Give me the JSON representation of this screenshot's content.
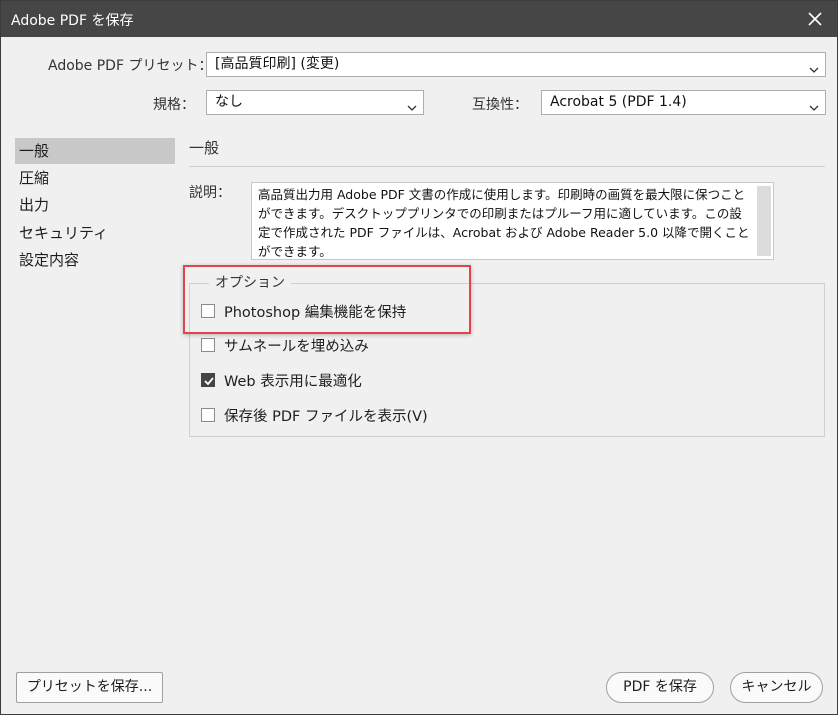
{
  "window": {
    "title": "Adobe PDF を保存"
  },
  "preset": {
    "label": "Adobe PDF プリセット：",
    "value": "[高品質印刷] (変更)"
  },
  "standard": {
    "label": "規格：",
    "value": "なし"
  },
  "compatibility": {
    "label": "互換性：",
    "value": "Acrobat 5 (PDF 1.4)"
  },
  "sidebar": {
    "items": [
      {
        "label": "一般",
        "selected": true
      },
      {
        "label": "圧縮",
        "selected": false
      },
      {
        "label": "出力",
        "selected": false
      },
      {
        "label": "セキュリティ",
        "selected": false
      },
      {
        "label": "設定内容",
        "selected": false
      }
    ]
  },
  "main": {
    "section_title": "一般",
    "description_label": "説明：",
    "description_text": "高品質出力用 Adobe PDF 文書の作成に使用します。印刷時の画質を最大限に保つことができます。デスクトッププリンタでの印刷またはプルーフ用に適しています。この設定で作成された PDF ファイルは、Acrobat および Adobe Reader 5.0 以降で開くことができます。",
    "options_title": "オプション",
    "options": [
      {
        "label": "Photoshop 編集機能を保持",
        "checked": false
      },
      {
        "label": "サムネールを埋め込み",
        "checked": false
      },
      {
        "label": "Web 表示用に最適化",
        "checked": true
      },
      {
        "label": "保存後 PDF ファイルを表示(V)",
        "checked": false
      }
    ]
  },
  "footer": {
    "save_preset_label": "プリセットを保存...",
    "save_pdf_label": "PDF を保存",
    "cancel_label": "キャンセル"
  },
  "colors": {
    "titlebar": "#464646",
    "highlight": "#e0454b",
    "selected_item": "#c8c8c8",
    "checkbox_checked": "#444444"
  }
}
